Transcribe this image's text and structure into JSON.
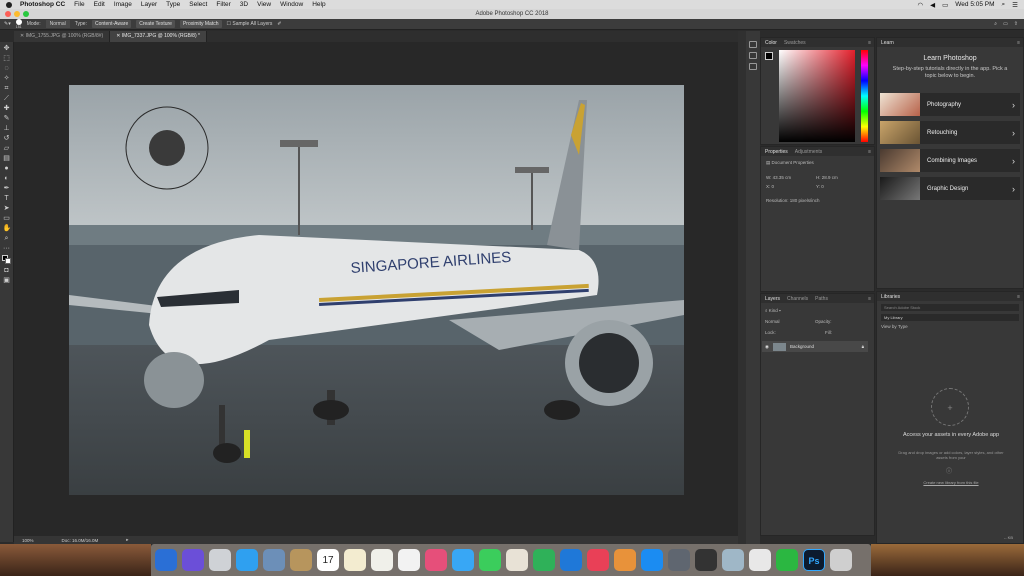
{
  "menubar": {
    "app": "Photoshop CC",
    "items": [
      "File",
      "Edit",
      "Image",
      "Layer",
      "Type",
      "Select",
      "Filter",
      "3D",
      "View",
      "Window",
      "Help"
    ],
    "clock": "Wed 5:05 PM"
  },
  "window": {
    "title": "Adobe Photoshop CC 2018"
  },
  "options": {
    "size": "151",
    "mode_label": "Mode:",
    "mode_value": "Normal",
    "type_label": "Type:",
    "btn_content_aware": "Content-Aware",
    "btn_create_texture": "Create Texture",
    "btn_proximity_match": "Proximity Match",
    "sample_all_layers": "Sample All Layers"
  },
  "tabs": [
    {
      "label": "IMG_1755.JPG @ 100% (RGB/8#)"
    },
    {
      "label": "IMG_7337.JPG @ 100% (RGB/8) *"
    }
  ],
  "status": {
    "zoom": "100%",
    "doc": "Doc: 16.0M/16.0M"
  },
  "color_panel": {
    "tab_color": "Color",
    "tab_swatches": "Swatches"
  },
  "properties_panel": {
    "tab_properties": "Properties",
    "tab_adjustments": "Adjustments",
    "doc_title": "Document Properties",
    "w": "W:  43.35 cm",
    "h": "H:  28.9 cm",
    "x": "X:  0",
    "y": "Y:  0",
    "resolution": "Resolution: 180 pixels/inch"
  },
  "layers_panel": {
    "tab_layers": "Layers",
    "tab_channels": "Channels",
    "tab_paths": "Paths",
    "kind": "Kind",
    "blend": "Normal",
    "opacity": "Opacity:",
    "lock": "Lock:",
    "fill": "Fill:",
    "layer_name": "Background"
  },
  "learn_panel": {
    "tab": "Learn",
    "title": "Learn Photoshop",
    "subtitle": "Step-by-step tutorials directly in the app. Pick a topic below to begin.",
    "topics": [
      "Photography",
      "Retouching",
      "Combining Images",
      "Graphic Design"
    ]
  },
  "libraries_panel": {
    "tab": "Libraries",
    "search_placeholder": "Search Adobe Stock",
    "library": "My Library",
    "view_by": "View by Type",
    "access_title": "Access your assets in every Adobe app",
    "access_sub": "Drag and drop images or add colors, layer styles, and other assets from your",
    "create_link": "Create new library from this file",
    "kb": "-- KB"
  },
  "dock": {
    "calendar_day": "17",
    "app_colors": [
      "#2a6fd6",
      "#6b4fd8",
      "#cfd2d6",
      "#2fa0f0",
      "#6c8fb8",
      "#b7955d",
      "#e3b34a",
      "#f3ecd0",
      "#f0f0ea",
      "#f2f2f2",
      "#e64f7a",
      "#38a7f5",
      "#3bcd5c",
      "#e8e2d6",
      "#2fb159",
      "#1f78d8",
      "#e94057",
      "#e8923a",
      "#1b8cf2",
      "#5f6670",
      "#333333",
      "#9fb7c7",
      "#e8e8e8",
      "#2bb741",
      "#2f74c0",
      "#cfcfcf"
    ],
    "ps_label": "Ps"
  }
}
